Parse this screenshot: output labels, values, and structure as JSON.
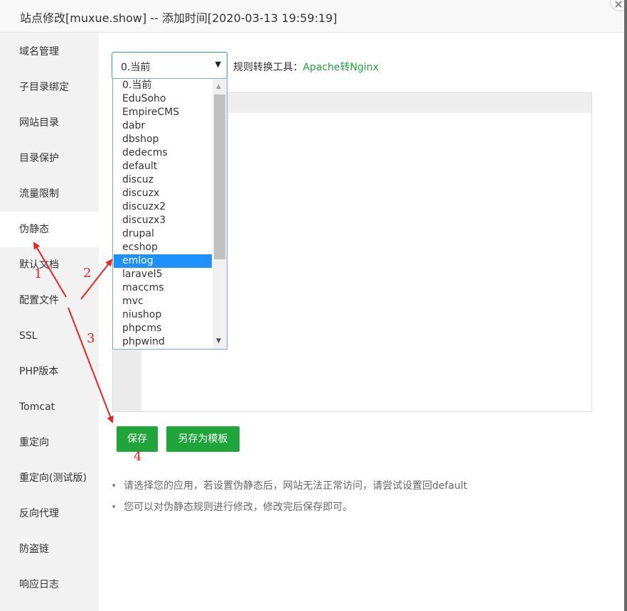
{
  "window": {
    "title": "站点修改[muxue.show] -- 添加时间[2020-03-13 19:59:19]"
  },
  "sidebar": {
    "items": [
      {
        "label": "域名管理"
      },
      {
        "label": "子目录绑定"
      },
      {
        "label": "网站目录"
      },
      {
        "label": "目录保护"
      },
      {
        "label": "流量限制"
      },
      {
        "label": "伪静态",
        "active": true
      },
      {
        "label": "默认文档"
      },
      {
        "label": "配置文件"
      },
      {
        "label": "SSL"
      },
      {
        "label": "PHP版本"
      },
      {
        "label": "Tomcat"
      },
      {
        "label": "重定向"
      },
      {
        "label": "重定向(测试版)"
      },
      {
        "label": "反向代理"
      },
      {
        "label": "防盗链"
      },
      {
        "label": "响应日志"
      }
    ]
  },
  "rewrite": {
    "select_value": "0.当前",
    "tool_label": "规则转换工具：",
    "tool_link": "Apache转Nginx",
    "options": [
      "0.当前",
      "EduSoho",
      "EmpireCMS",
      "dabr",
      "dbshop",
      "dedecms",
      "default",
      "discuz",
      "discuzx",
      "discuzx2",
      "discuzx3",
      "drupal",
      "ecshop",
      "emlog",
      "laravel5",
      "maccms",
      "mvc",
      "niushop",
      "phpcms",
      "phpwind"
    ],
    "highlighted_option": "emlog",
    "save_label": "保存",
    "save_template_label": "另存为模板",
    "notes": [
      "请选择您的应用，若设置伪静态后，网站无法正常访问，请尝试设置回default",
      "您可以对伪静态规则进行修改，修改完后保存即可。"
    ]
  },
  "annotations": {
    "step1": "1",
    "step2": "2",
    "step3": "3",
    "step4": "4",
    "arrow_color": "#e8251e"
  },
  "colors": {
    "accent": "#20a53a",
    "selection": "#1e90ff"
  }
}
